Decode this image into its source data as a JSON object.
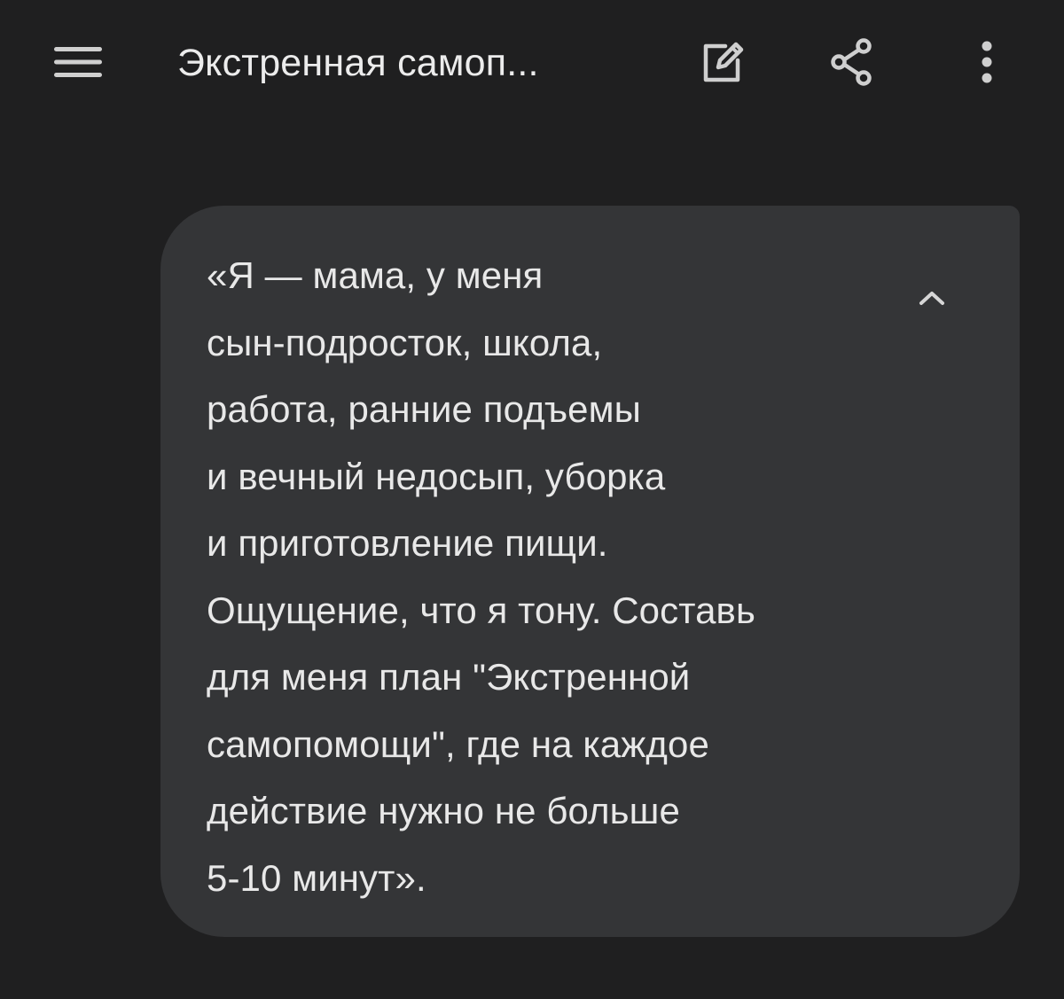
{
  "header": {
    "title": "Экстренная самоп...",
    "icons": {
      "menu": "menu-icon",
      "edit": "edit-icon",
      "share": "share-icon",
      "more": "more-vert-icon"
    }
  },
  "message": {
    "text": "«Я — мама, у меня\nсын-подросток, школа,\nработа, ранние подъемы\nи вечный недосып, уборка\nи приготовление пищи.\nОщущение, что я тону. Составь\nдля меня план \"Экстренной\nсамопомощи\", где на каждое\nдействие нужно не больше\n5-10 минут».",
    "collapse_icon": "chevron-up-icon"
  },
  "colors": {
    "background": "#1f1f20",
    "bubble": "#343537",
    "text": "#e8e8e8",
    "icon": "#cfcfcf"
  }
}
